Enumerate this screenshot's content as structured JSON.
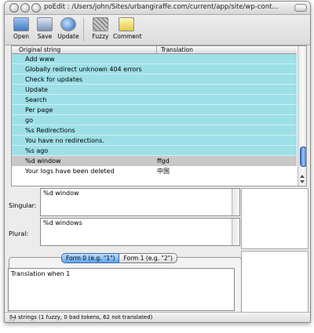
{
  "window": {
    "title": "poEdit : /Users/john/Sites/urbangiraffe.com/current/app/site/wp-cont..."
  },
  "toolbar": {
    "buttons": [
      {
        "id": "open",
        "label": "Open",
        "icon": "open-folder-icon"
      },
      {
        "id": "save",
        "label": "Save",
        "icon": "save-disk-icon"
      },
      {
        "id": "update",
        "label": "Update",
        "icon": "update-globe-icon"
      },
      {
        "id": "fuzzy",
        "label": "Fuzzy",
        "icon": "fuzzy-icon"
      },
      {
        "id": "comment",
        "label": "Comment",
        "icon": "comment-note-icon"
      }
    ]
  },
  "list": {
    "headers": {
      "original": "Original string",
      "translation": "Translation"
    },
    "rows": [
      {
        "original": "Add www",
        "translation": "",
        "state": "fuzzy"
      },
      {
        "original": "Globally redirect unknown 404 errors",
        "translation": "",
        "state": "fuzzy"
      },
      {
        "original": "Check for updates",
        "translation": "",
        "state": "fuzzy"
      },
      {
        "original": "Update",
        "translation": "",
        "state": "fuzzy"
      },
      {
        "original": "Search",
        "translation": "",
        "state": "fuzzy"
      },
      {
        "original": "Per page",
        "translation": "",
        "state": "fuzzy"
      },
      {
        "original": "go",
        "translation": "",
        "state": "fuzzy"
      },
      {
        "original": "%s Redirections",
        "translation": "",
        "state": "fuzzy"
      },
      {
        "original": "You have no redirections.",
        "translation": "",
        "state": "fuzzy"
      },
      {
        "original": "%s ago",
        "translation": "",
        "state": "fuzzy"
      },
      {
        "original": "%d window",
        "translation": "ffgd",
        "state": "selected"
      },
      {
        "original": "Your logs have been deleted",
        "translation": "中国",
        "state": "normal"
      }
    ]
  },
  "editor": {
    "singular_label": "Singular:",
    "singular_value": "%d window",
    "plural_label": "Plural:",
    "plural_value": "%d windows",
    "tabs": [
      {
        "label": "Form 0 (e.g. \"1\")",
        "active": true
      },
      {
        "label": "Form 1 (e.g. \"2\")",
        "active": false
      }
    ],
    "translation_value": "Translation when 1"
  },
  "status": {
    "text": "64 strings (1 fuzzy, 0 bad tokens, 62 not translated)"
  },
  "colors": {
    "fuzzy_row": "#9ee0e8",
    "selected_row": "#c8c8c8",
    "active_tab": "#5fa3ea"
  }
}
